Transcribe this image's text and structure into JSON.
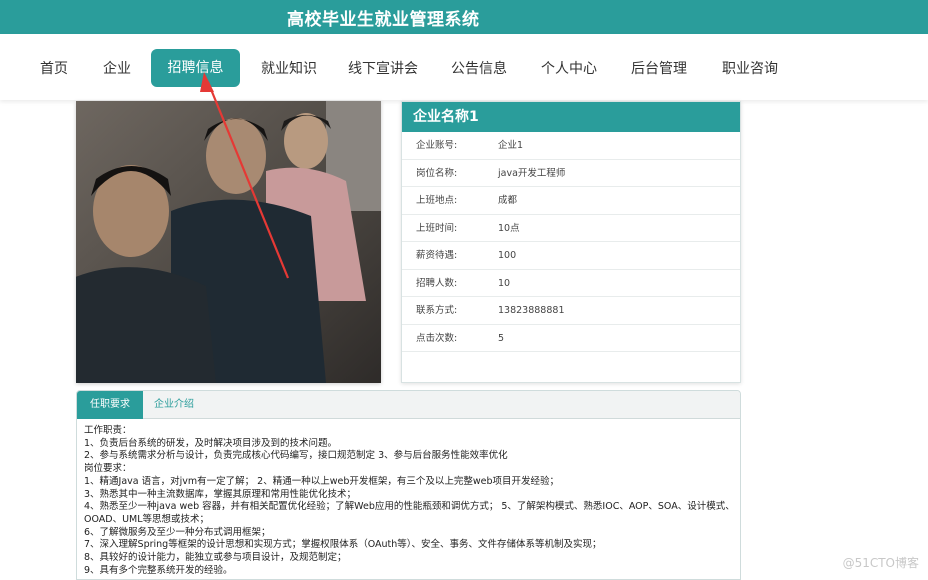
{
  "header": {
    "title": "高校毕业生就业管理系统"
  },
  "nav": {
    "items": [
      {
        "label": "首页"
      },
      {
        "label": "企业"
      },
      {
        "label": "招聘信息",
        "active": true
      },
      {
        "label": "就业知识"
      },
      {
        "label": "线下宣讲会"
      },
      {
        "label": "公告信息"
      },
      {
        "label": "个人中心"
      },
      {
        "label": "后台管理"
      },
      {
        "label": "职业咨询"
      }
    ]
  },
  "company": {
    "name": "企业名称1",
    "fields": [
      {
        "label": "企业账号:",
        "value": "企业1"
      },
      {
        "label": "岗位名称:",
        "value": "java开发工程师"
      },
      {
        "label": "上班地点:",
        "value": "成都"
      },
      {
        "label": "上班时间:",
        "value": "10点"
      },
      {
        "label": "薪资待遇:",
        "value": "100"
      },
      {
        "label": "招聘人数:",
        "value": "10"
      },
      {
        "label": "联系方式:",
        "value": "13823888881"
      },
      {
        "label": "点击次数:",
        "value": "5"
      }
    ]
  },
  "tabs": {
    "items": [
      {
        "label": "任职要求",
        "active": true
      },
      {
        "label": "企业介绍"
      }
    ]
  },
  "requirements": {
    "lines": [
      "工作职责：",
      "1、负责后台系统的研发，及时解决项目涉及到的技术问题。",
      "2、参与系统需求分析与设计，负责完成核心代码编写，接口规范制定 3、参与后台服务性能效率优化",
      "岗位要求：",
      "1、精通Java 语言，对jvm有一定了解； 2、精通一种以上web开发框架，有三个及以上完整web项目开发经验；",
      "3、熟悉其中一种主流数据库，掌握其原理和常用性能优化技术；",
      "4、熟悉至少一种java web 容器，并有相关配置优化经验；了解Web应用的性能瓶颈和调优方式； 5、了解架构模式、熟悉IOC、AOP、SOA、设计模式、",
      "OOAD、UML等思想或技术；",
      "6、了解微服务及至少一种分布式调用框架；",
      "7、深入理解Spring等框架的设计思想和实现方式；掌握权限体系（OAuth等）、安全、事务、文件存储体系等机制及实现；",
      "8、具较好的设计能力，能独立或参与项目设计，及规范制定；",
      "9、具有多个完整系统开发的经验。"
    ]
  },
  "watermark": {
    "text": "@51CTO博客"
  },
  "colors": {
    "accent": "#2a9d9b",
    "annotation_arrow": "#e53935"
  }
}
